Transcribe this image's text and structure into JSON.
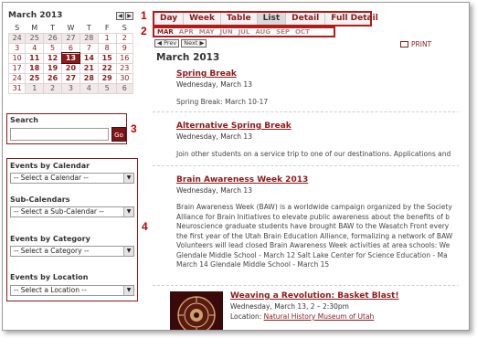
{
  "calendar": {
    "month_title": "March 2013",
    "nav": [
      "◀",
      "▶"
    ],
    "weekdays": [
      "S",
      "M",
      "T",
      "W",
      "T",
      "F",
      "S"
    ],
    "weeks": [
      [
        {
          "d": "24",
          "c": "other"
        },
        {
          "d": "25",
          "c": "other"
        },
        {
          "d": "26",
          "c": "other"
        },
        {
          "d": "27",
          "c": "other"
        },
        {
          "d": "28",
          "c": "other"
        },
        {
          "d": "1",
          "c": ""
        },
        {
          "d": "2",
          "c": ""
        }
      ],
      [
        {
          "d": "3",
          "c": ""
        },
        {
          "d": "4",
          "c": ""
        },
        {
          "d": "5",
          "c": ""
        },
        {
          "d": "6",
          "c": ""
        },
        {
          "d": "7",
          "c": ""
        },
        {
          "d": "8",
          "c": ""
        },
        {
          "d": "9",
          "c": ""
        }
      ],
      [
        {
          "d": "10",
          "c": ""
        },
        {
          "d": "11",
          "c": "bold"
        },
        {
          "d": "12",
          "c": "bold"
        },
        {
          "d": "13",
          "c": "today"
        },
        {
          "d": "14",
          "c": "bold"
        },
        {
          "d": "15",
          "c": "bold"
        },
        {
          "d": "16",
          "c": ""
        }
      ],
      [
        {
          "d": "17",
          "c": ""
        },
        {
          "d": "18",
          "c": "bold"
        },
        {
          "d": "19",
          "c": "bold"
        },
        {
          "d": "20",
          "c": "bold"
        },
        {
          "d": "21",
          "c": "bold"
        },
        {
          "d": "22",
          "c": "bold"
        },
        {
          "d": "23",
          "c": ""
        }
      ],
      [
        {
          "d": "24",
          "c": ""
        },
        {
          "d": "25",
          "c": "bold"
        },
        {
          "d": "26",
          "c": "bold"
        },
        {
          "d": "27",
          "c": "bold"
        },
        {
          "d": "28",
          "c": "bold"
        },
        {
          "d": "29",
          "c": "bold"
        },
        {
          "d": "30",
          "c": ""
        }
      ],
      [
        {
          "d": "31",
          "c": ""
        },
        {
          "d": "1",
          "c": "other"
        },
        {
          "d": "2",
          "c": "other"
        },
        {
          "d": "3",
          "c": "other"
        },
        {
          "d": "4",
          "c": "other"
        },
        {
          "d": "5",
          "c": "other"
        },
        {
          "d": "6",
          "c": "other"
        }
      ]
    ]
  },
  "search": {
    "label": "Search",
    "value": "",
    "go_label": "Go"
  },
  "filters": [
    {
      "label": "Events by Calendar",
      "selected": "-- Select a Calendar --"
    },
    {
      "label": "Sub-Calendars",
      "selected": "-- Select a Sub-Calendar --"
    },
    {
      "label": "Events by Category",
      "selected": "-- Select a Category --"
    },
    {
      "label": "Events by Location",
      "selected": "-- Select a Location --"
    }
  ],
  "annotations": [
    "1",
    "2",
    "3",
    "4"
  ],
  "tabs": [
    "Day",
    "Week",
    "Table",
    "List",
    "Detail",
    "Full Detail"
  ],
  "active_tab": "List",
  "months": [
    "MAR",
    "APR",
    "MAY",
    "JUN",
    "JUL",
    "AUG",
    "SEP",
    "OCT"
  ],
  "prev_label": "◀ Prev",
  "next_label": "Next ▶",
  "print_label": "PRINT",
  "month_heading": "March 2013",
  "events": [
    {
      "title": "Spring Break",
      "date": "Wednesday, March 13",
      "body": [
        "Spring Break:  March 10-17"
      ]
    },
    {
      "title": "Alternative Spring Break",
      "date": "Wednesday, March 13",
      "body": [
        "Join other students on a service trip to one of our destinations. Applications and"
      ]
    },
    {
      "title": "Brain Awareness Week 2013",
      "date": "Wednesday, March 13",
      "body": [
        "Brain Awareness Week (BAW) is a worldwide campaign organized by the Society",
        "Alliance for Brain Initiatives to elevate public awareness about the benefits of b",
        "Neuroscience graduate students have brought BAW to the Wasatch Front every",
        "the first year of the Utah Brain Education Alliance, formalizing a network of BAW",
        "Volunteers will lead closed Brain Awareness Week activities at area schools: We",
        "Glendale Middle School - March 12 Salt Lake Center for Science Education - Ma",
        "March 14 Glendale Middle School - March 15"
      ]
    },
    {
      "title": "Weaving a Revolution: Basket Blast!",
      "date": "Wednesday, March 13, 2 – 2:30pm",
      "location_label": "Location:",
      "location": "Natural History Museum of Utah"
    }
  ],
  "colors": {
    "accent": "#8b1a1a",
    "annotation": "#c00000"
  }
}
